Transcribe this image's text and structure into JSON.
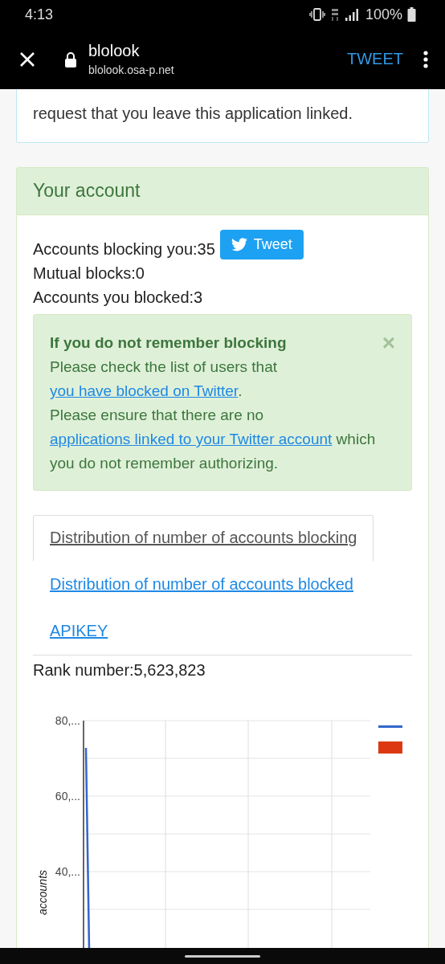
{
  "status_bar": {
    "time": "4:13",
    "battery": "100%"
  },
  "browser_bar": {
    "title": "blolook",
    "url": "blolook.osa-p.net",
    "action": "TWEET"
  },
  "notice_card": {
    "lines": [
      "request that you leave this application linked."
    ]
  },
  "account_card": {
    "title": "Your account",
    "tweet_button": "Tweet",
    "stats": [
      "Accounts blocking you:35",
      "Mutual blocks:0",
      "Accounts you blocked:3"
    ],
    "alert": {
      "title": "If you do not remember blocking",
      "close": "×",
      "paragraphs": [
        [
          {
            "text": "Please check the list of users that "
          },
          {
            "text": "you have blocked on Twitter",
            "link": true
          },
          {
            "text": "."
          }
        ],
        [
          {
            "text": "Please ensure that there are no "
          },
          {
            "text": "applications linked to your Twitter account",
            "link": true
          },
          {
            "text": " which you do not remember authorizing."
          }
        ]
      ]
    },
    "tabs": [
      {
        "label": "Distribution of number of accounts blocking",
        "selected": true
      },
      {
        "label": "Distribution of number of accounts blocked",
        "selected": false
      },
      {
        "label": "APIKEY",
        "selected": false
      }
    ],
    "rank": "Rank number:5,623,823",
    "chart": {
      "ylabel": "accounts",
      "y_tick_labels": [
        "80,...",
        "60,...",
        "40,..."
      ],
      "legend": [
        {
          "kind": "line",
          "color": "#3366cc"
        },
        {
          "kind": "swatch",
          "color": "#dc3912"
        }
      ]
    }
  }
}
